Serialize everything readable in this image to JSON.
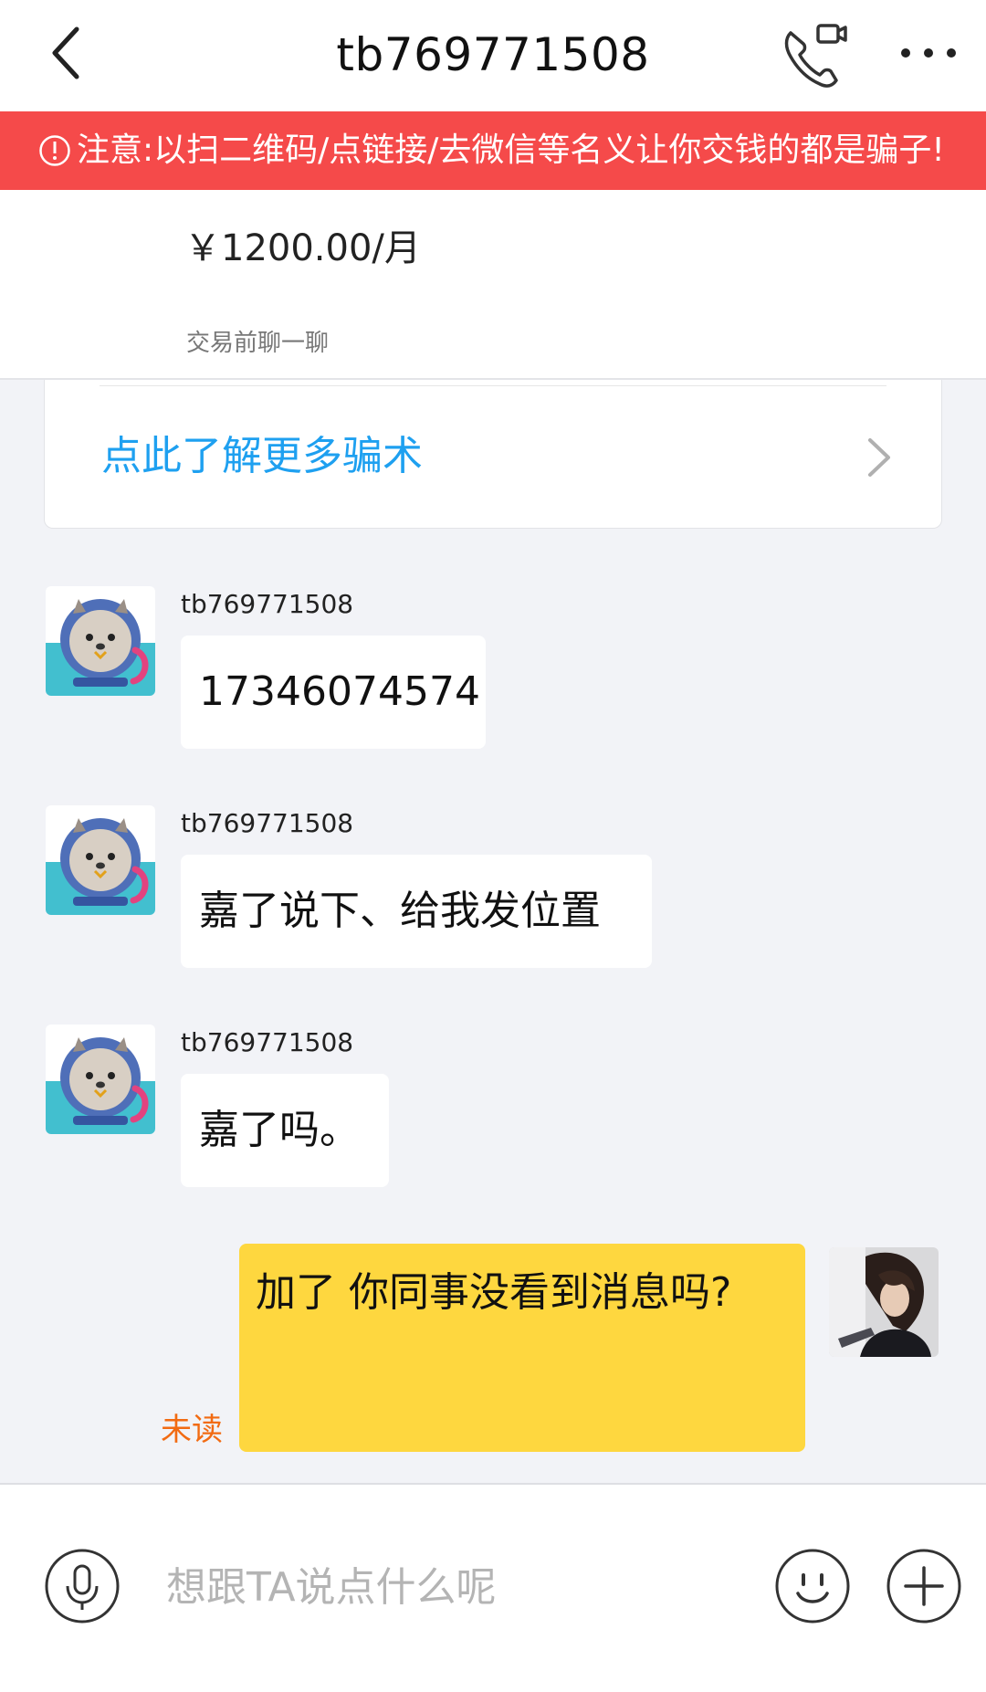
{
  "header": {
    "title": "tb769771508"
  },
  "warning": {
    "text": "注意:以扫二维码/点链接/去微信等名义让你交钱的都是骗子!"
  },
  "product": {
    "price": "￥1200.00/月",
    "hint": "交易前聊一聊"
  },
  "tips": {
    "link_text": "点此了解更多骗术"
  },
  "messages": [
    {
      "sender": "tb769771508",
      "text": "17346074574"
    },
    {
      "sender": "tb769771508",
      "text": "嘉了说下、给我发位置"
    },
    {
      "sender": "tb769771508",
      "text": "嘉了吗。"
    }
  ],
  "self_message": {
    "text": "加了 你同事没看到消息吗?",
    "status": "未读"
  },
  "input": {
    "placeholder": "想跟TA说点什么呢"
  },
  "colors": {
    "warning_bg": "#f54a4a",
    "link": "#1ea0f0",
    "self_bubble": "#fed73f",
    "unread": "#f26b12"
  },
  "icons": [
    "back-arrow-icon",
    "video-call-icon",
    "more-icon",
    "alert-icon",
    "chevron-right-icon",
    "microphone-icon",
    "emoji-icon",
    "plus-icon"
  ]
}
